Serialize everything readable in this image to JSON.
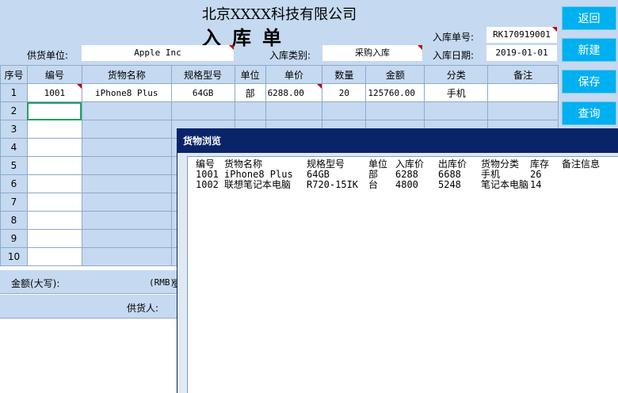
{
  "header": {
    "company": "北京XXXX科技有限公司",
    "form_title": "入库单",
    "supplier_label": "供货单位:",
    "supplier_value": "Apple Inc",
    "type_label": "入库类别:",
    "type_value": "采购入库",
    "order_no_label": "入库单号:",
    "order_no_value": "RK170919001",
    "date_label": "入库日期:",
    "date_value": "2019-01-01"
  },
  "table": {
    "columns": [
      "序号",
      "编号",
      "货物名称",
      "规格型号",
      "单位",
      "单价",
      "数量",
      "金额",
      "分类",
      "备注"
    ],
    "row_numbers": [
      "1",
      "2",
      "3",
      "4",
      "5",
      "6",
      "7",
      "8",
      "9",
      "10"
    ],
    "first_row": {
      "code": "1001",
      "name": "iPhone8 Plus",
      "spec": "64GB",
      "unit": "部",
      "price": "6288.00",
      "qty": "20",
      "amount": "125760.00",
      "category": "手机",
      "note": ""
    }
  },
  "summary": {
    "amount_words_label": "金额(大写):",
    "rmb_prefix": "(RMB)",
    "rmb_cut": "壹",
    "supplier_person_label": "供货人:"
  },
  "buttons": {
    "back": "返回",
    "new": "新建",
    "save": "保存",
    "query": "查询"
  },
  "dialog": {
    "title": "货物浏览",
    "columns": [
      "编号",
      "货物名称",
      "规格型号",
      "单位",
      "入库价",
      "出库价",
      "货物分类",
      "库存",
      "备注信息"
    ],
    "rows": [
      [
        "1001",
        "iPhone8 Plus",
        "64GB",
        "部",
        "6288",
        "6688",
        "手机",
        "26",
        ""
      ],
      [
        "1002",
        "联想笔记本电脑",
        "R720-15IK",
        "台",
        "4800",
        "5248",
        "笔记本电脑",
        "14",
        ""
      ]
    ]
  },
  "colors": {
    "sheet_blue": "#c5d9f1",
    "button_blue": "#00b0f0",
    "dialog_title": "#0a246a",
    "selection_green": "#21a366"
  }
}
